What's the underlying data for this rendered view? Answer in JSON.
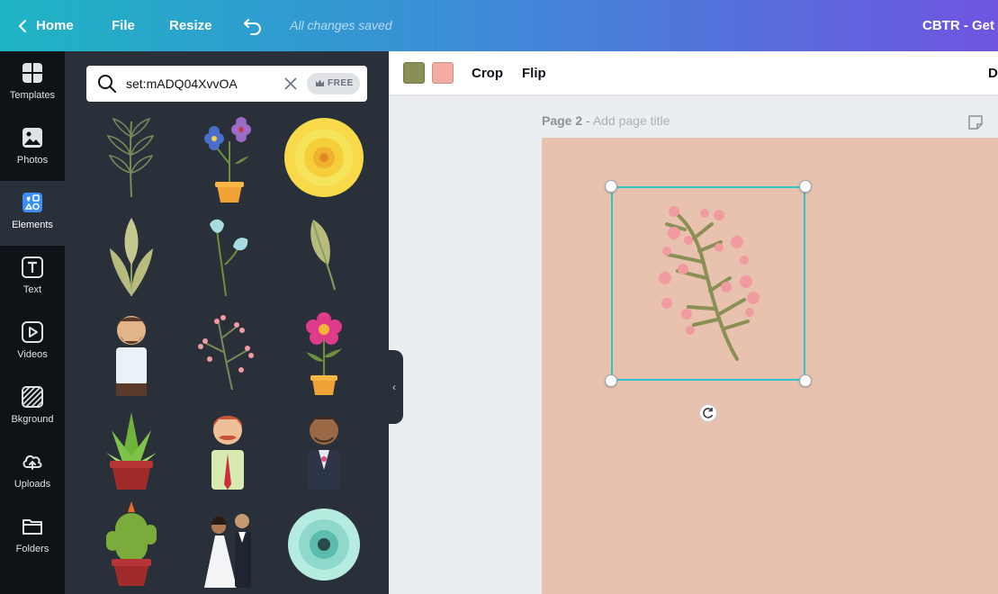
{
  "topbar": {
    "home_label": "Home",
    "file_label": "File",
    "resize_label": "Resize",
    "save_status": "All changes saved",
    "design_title": "CBTR - Get to"
  },
  "rail": {
    "items": [
      {
        "label": "Templates",
        "icon": "templates-icon"
      },
      {
        "label": "Photos",
        "icon": "photos-icon"
      },
      {
        "label": "Elements",
        "icon": "elements-icon"
      },
      {
        "label": "Text",
        "icon": "text-icon"
      },
      {
        "label": "Videos",
        "icon": "videos-icon"
      },
      {
        "label": "Bkground",
        "icon": "background-icon"
      },
      {
        "label": "Uploads",
        "icon": "uploads-icon"
      },
      {
        "label": "Folders",
        "icon": "folders-icon"
      }
    ]
  },
  "search": {
    "value": "set:mADQ04XvvOA",
    "badge": "FREE"
  },
  "elements": [
    "leaf-branch-outline",
    "potted-blue-purple-flowers",
    "yellow-dahlia",
    "green-leaves",
    "blue-flowers-stem",
    "single-leaf",
    "man-with-beard",
    "pink-berry-sprig",
    "pink-flower-pot",
    "potted-succulent",
    "red-haired-man",
    "man-in-suit",
    "potted-cactus",
    "bride-and-groom",
    "mint-dahlia"
  ],
  "toolbar": {
    "colors": [
      "#8a8f55",
      "#f2aca2"
    ],
    "crop_label": "Crop",
    "flip_label": "Flip",
    "cut_label": "D"
  },
  "page": {
    "label": "Page 2",
    "separator": " - ",
    "title_placeholder": "Add page title",
    "background": "#e8c2af"
  }
}
